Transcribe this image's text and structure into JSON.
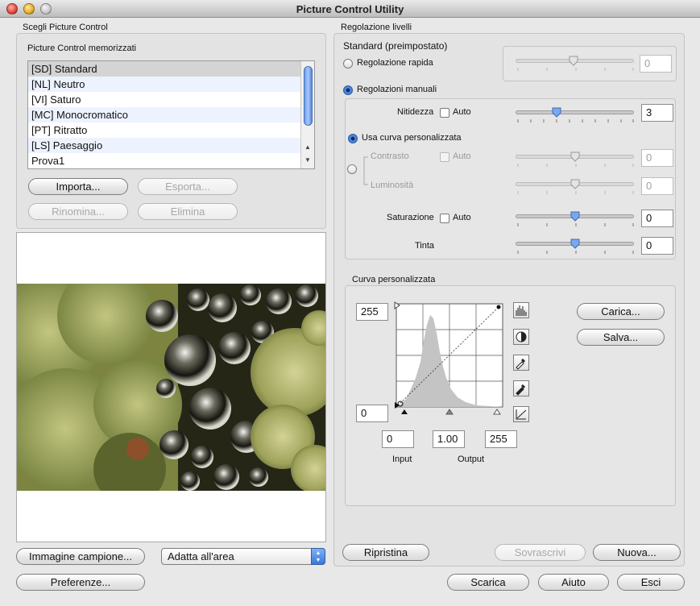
{
  "window": {
    "title": "Picture Control Utility"
  },
  "left": {
    "group_label": "Scegli Picture Control",
    "list_label": "Picture Control memorizzati",
    "items": [
      {
        "label": "[SD] Standard"
      },
      {
        "label": "[NL] Neutro"
      },
      {
        "label": "[VI] Saturo"
      },
      {
        "label": "[MC] Monocromatico"
      },
      {
        "label": "[PT] Ritratto"
      },
      {
        "label": "[LS] Paesaggio"
      },
      {
        "label": "Prova1"
      }
    ],
    "buttons": {
      "import": "Importa...",
      "export": "Esporta...",
      "rename": "Rinomina...",
      "delete": "Elimina"
    },
    "sample_button": "Immagine campione...",
    "fit_select": "Adatta all'area",
    "preferences_button": "Preferenze..."
  },
  "right": {
    "group_label": "Regolazione livelli",
    "base_label": "Standard (preimpostato)",
    "quick_label": "Regolazione rapida",
    "quick_value": "0",
    "manual_label": "Regolazioni manuali",
    "sharpness": {
      "label": "Nitidezza",
      "auto": "Auto",
      "value": "3"
    },
    "custom_curve_label": "Usa curva personalizzata",
    "contrast": {
      "label": "Contrasto",
      "auto": "Auto",
      "value": "0"
    },
    "brightness": {
      "label": "Luminosità",
      "value": "0"
    },
    "saturation": {
      "label": "Saturazione",
      "auto": "Auto",
      "value": "0"
    },
    "hue": {
      "label": "Tinta",
      "value": "0"
    },
    "curve": {
      "group_label": "Curva personalizzata",
      "top_value": "255",
      "bottom_value": "0",
      "input_value": "0",
      "gamma_value": "1.00",
      "output_value": "255",
      "input_label": "Input",
      "output_label": "Output",
      "load_button": "Carica...",
      "save_button": "Salva..."
    },
    "reset_button": "Ripristina",
    "overwrite_button": "Sovrascrivi",
    "new_button": "Nuova..."
  },
  "footer": {
    "download_button": "Scarica",
    "help_button": "Aiuto",
    "exit_button": "Esci"
  },
  "colors": {
    "accent": "#3a78d8",
    "selection": "#d4d4d4",
    "alt_row": "#edf3fe"
  }
}
